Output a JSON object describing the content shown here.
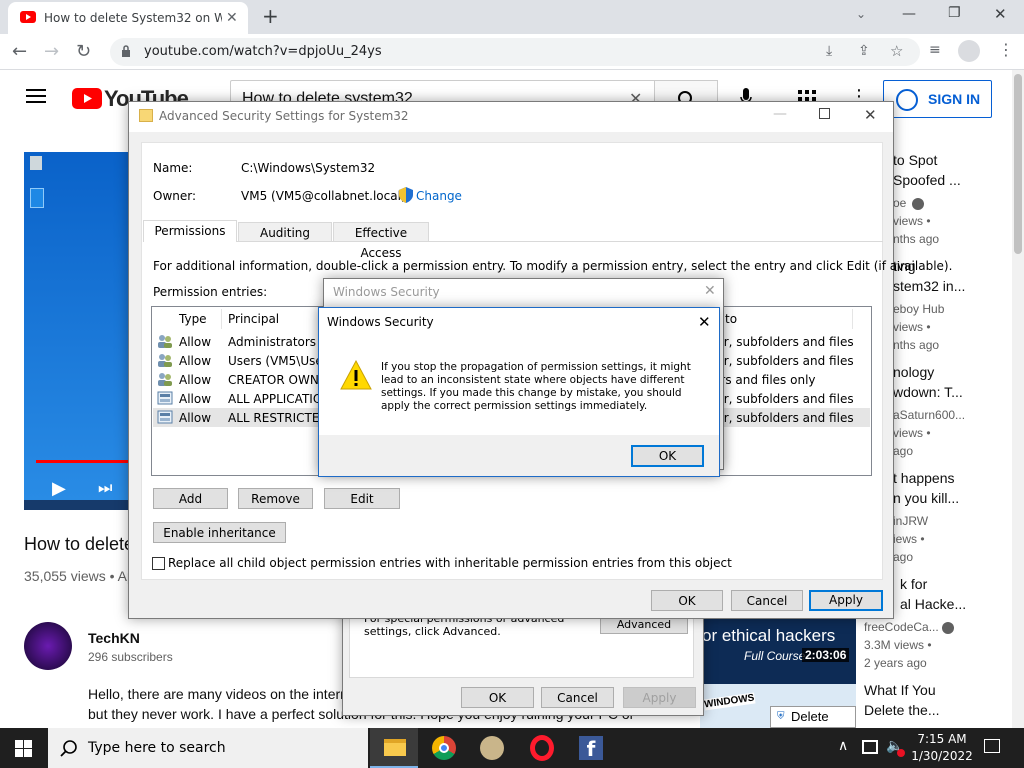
{
  "browser": {
    "tab_title": "How to delete System32 on Win",
    "url": "youtube.com/watch?v=dpjoUu_24ys"
  },
  "youtube": {
    "logo_text": "YouTube",
    "search_value": "How to delete system32",
    "signin_label": "SIGN IN",
    "video_title": "How to delete",
    "views": "35,055 views • Ap",
    "channel_name": "TechKN",
    "subscribers": "296 subscribers",
    "description_line1": "Hello, there are many videos on the intern",
    "description_line2": "but they never work. I have a perfect solution for this. Hope you enjoy ruining your PC or",
    "recommendations": [
      {
        "line1": "to Spot",
        "line2": "Spoofed ...",
        "channel": "oe",
        "views": "views •",
        "age": "nths ago"
      },
      {
        "line1": "ting",
        "line2": "stem32 in...",
        "channel": "eboy Hub",
        "views": "views •",
        "age": "nths ago"
      },
      {
        "line1": "nology",
        "line2": "wdown: T...",
        "channel": "aSaturn600...",
        "views": "views •",
        "age": "ago"
      },
      {
        "line1": "t happens",
        "line2": "n you kill...",
        "channel": "inJRW",
        "views": "iews •",
        "age": "ago"
      },
      {
        "line1": "k for",
        "line2": "al Hacke...",
        "channel": "freeCodeCa...",
        "views": "3.3M views •",
        "age": "2 years ago"
      },
      {
        "line1": "What If You",
        "line2": "Delete the...",
        "channel": "",
        "views": "",
        "age": ""
      }
    ],
    "thumb_text": "or ethical hackers",
    "thumb_full_course": "Full Course",
    "thumb_duration": "2:03:06",
    "thumb_windows": "WINDOWS",
    "thumb_delete": "Delete"
  },
  "props_dialog": {
    "note": "For special permissions or advanced settings, click Advanced.",
    "advanced_label": "Advanced",
    "ok_label": "OK",
    "cancel_label": "Cancel",
    "apply_label": "Apply"
  },
  "adv_dialog": {
    "title": "Advanced Security Settings for System32",
    "name_label": "Name:",
    "name_value": "C:\\Windows\\System32",
    "owner_label": "Owner:",
    "owner_value": "VM5 (VM5@collabnet.local)",
    "change_label": "Change",
    "tabs": [
      "Permissions",
      "Auditing",
      "Effective Access"
    ],
    "info": "For additional information, double-click a permission entry. To modify a permission entry, select the entry and click Edit (if available).",
    "entries_label": "Permission entries:",
    "col_type": "Type",
    "col_principal": "Principal",
    "col_applies": "to",
    "rows": [
      {
        "type": "Allow",
        "principal": "Administrators (V",
        "applies": "ler, subfolders and files"
      },
      {
        "type": "Allow",
        "principal": "Users (VM5\\Users",
        "applies": "ler, subfolders and files"
      },
      {
        "type": "Allow",
        "principal": "CREATOR OWNER",
        "applies": "ers and files only"
      },
      {
        "type": "Allow",
        "principal": "ALL APPLICATION",
        "applies": "ler, subfolders and files"
      },
      {
        "type": "Allow",
        "principal": "ALL RESTRICTED A",
        "applies": "ler, subfolders and files"
      }
    ],
    "add_label": "Add",
    "remove_label": "Remove",
    "edit_label": "Edit",
    "enable_inheritance_label": "Enable inheritance",
    "replace_label": "Replace all child object permission entries with inheritable permission entries from this object",
    "ok_label": "OK",
    "cancel_label": "Cancel",
    "apply_label": "Apply"
  },
  "bg_security": {
    "title": "Windows Security"
  },
  "alert": {
    "title": "Windows Security",
    "message": "If you stop the propagation of permission settings, it might lead to an inconsistent state where objects have different settings. If you made this change by mistake, you should apply the correct permission settings immediately.",
    "ok_label": "OK"
  },
  "taskbar": {
    "search_placeholder": "Type here to search",
    "time": "7:15 AM",
    "date": "1/30/2022"
  }
}
